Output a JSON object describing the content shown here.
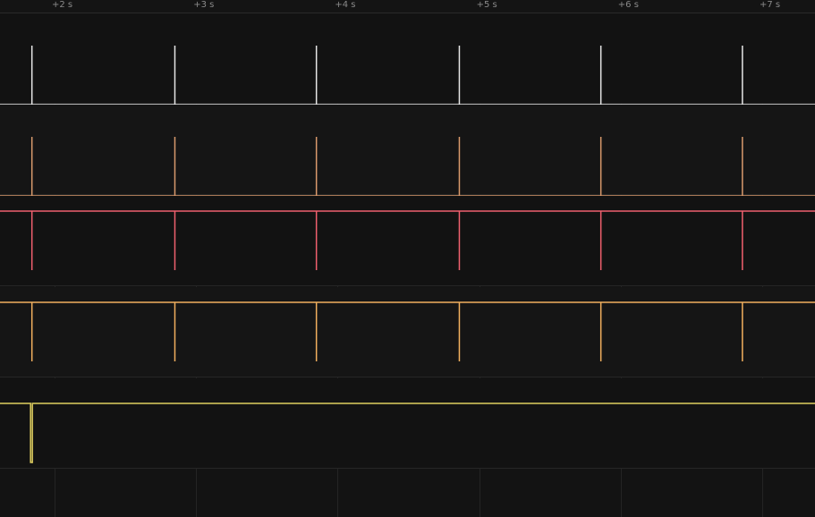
{
  "timeline": {
    "ticks": [
      {
        "label": "+2 s",
        "time": 2
      },
      {
        "label": "+3 s",
        "time": 3
      },
      {
        "label": "+4 s",
        "time": 4
      },
      {
        "label": "+5 s",
        "time": 5
      },
      {
        "label": "+6 s",
        "time": 6
      },
      {
        "label": "+7 s",
        "time": 7
      }
    ],
    "event_times": [
      1.84,
      2.85,
      3.85,
      4.86,
      5.86,
      6.86
    ],
    "marker_color": "#c98fe3"
  },
  "tracks": [
    {
      "id": "track-1",
      "color": "#e6e6e6",
      "baseline": "bottom",
      "spike": "up"
    },
    {
      "id": "track-2",
      "color": "#d99a6c",
      "baseline": "bottom",
      "spike": "up"
    },
    {
      "id": "track-3",
      "color": "#f0606e",
      "baseline": "top",
      "spike": "down"
    },
    {
      "id": "track-4",
      "color": "#f2b05e",
      "baseline": "top",
      "spike": "down"
    },
    {
      "id": "track-5",
      "color": "#e0d060",
      "baseline": "top",
      "spike": "pulse",
      "pulse_event_index": 0
    }
  ]
}
